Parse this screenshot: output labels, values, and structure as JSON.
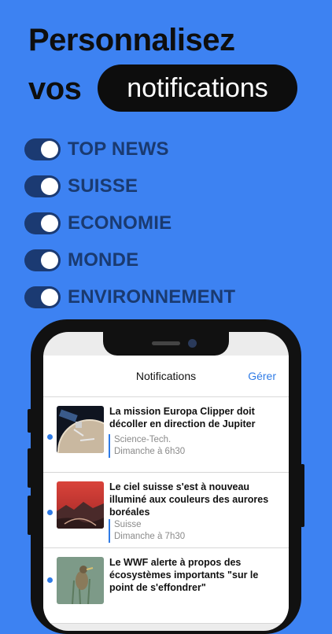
{
  "headline": {
    "line1": "Personnalisez",
    "line2_prefix": "vos",
    "pill": "notifications"
  },
  "toggles": [
    {
      "label": "TOP NEWS",
      "on": true
    },
    {
      "label": "SUISSE",
      "on": true
    },
    {
      "label": "ECONOMIE",
      "on": true
    },
    {
      "label": "MONDE",
      "on": true
    },
    {
      "label": "ENVIRONNEMENT",
      "on": true
    }
  ],
  "phone": {
    "nav": {
      "title": "Notifications",
      "action": "Gérer"
    },
    "notifications": [
      {
        "title": "La mission Europa Clipper doit décoller en direction de Jupiter",
        "category": "Science-Tech.",
        "time": "Dimanche à 6h30",
        "thumb_icon": "spacecraft-image"
      },
      {
        "title": "Le ciel suisse s'est à nouveau illuminé aux couleurs des aurores boréales",
        "category": "Suisse",
        "time": "Dimanche à 7h30",
        "thumb_icon": "aurora-image"
      },
      {
        "title": "Le WWF alerte à propos des écosystèmes importants \"sur le point de s'effondrer\"",
        "category": "",
        "time": "",
        "thumb_icon": "bird-image"
      }
    ]
  },
  "colors": {
    "background": "#3d82f2",
    "toggle_track": "#1b3a72",
    "accent": "#2f7be6"
  }
}
